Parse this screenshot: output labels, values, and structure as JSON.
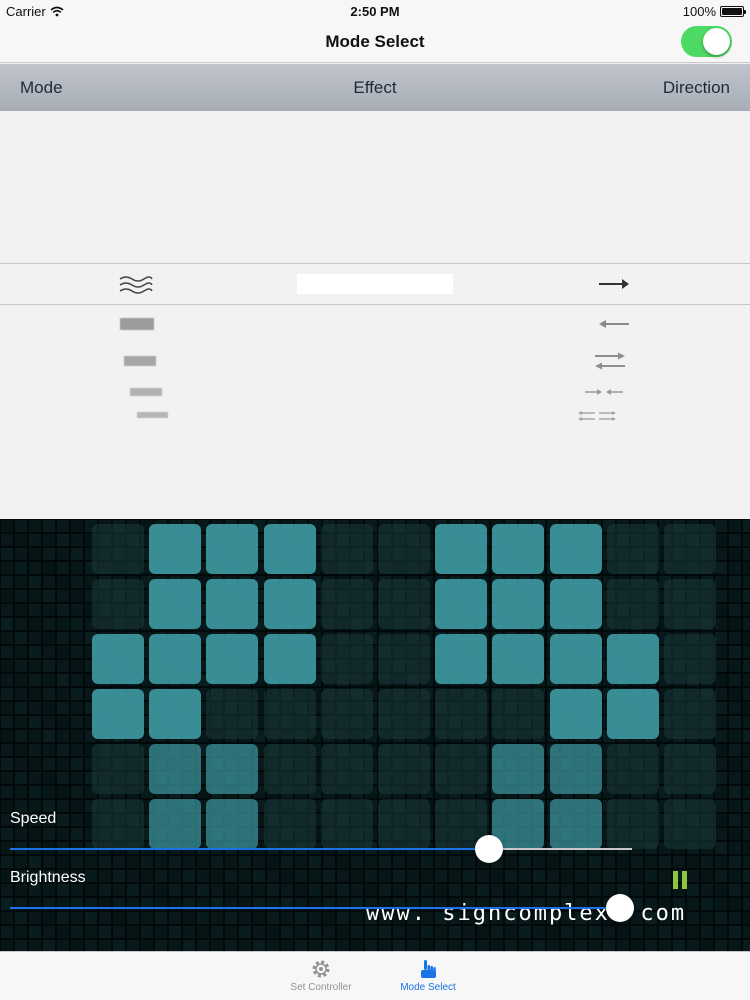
{
  "status_bar": {
    "carrier": "Carrier",
    "time": "2:50 PM",
    "battery": "100%"
  },
  "nav": {
    "title": "Mode Select",
    "toggle_on": true
  },
  "columns": {
    "mode": "Mode",
    "effect": "Effect",
    "direction": "Direction"
  },
  "picker": {
    "mode_icons": [
      "wave-icon",
      "bar-icon",
      "bar-icon",
      "bar-icon",
      "bar-icon"
    ],
    "direction_icons": [
      "arrow-right-icon",
      "arrow-left-icon",
      "arrows-bidirectional-icon",
      "arrows-converge-icon",
      "arrows-diverge-icon"
    ]
  },
  "preview": {
    "watermark": "www. signcomplex. com",
    "speed_label": "Speed",
    "speed_value": 0.77,
    "brightness_label": "Brightness",
    "brightness_value": 0.98,
    "pause_icon": "pause-icon",
    "accent": "#1a73e8",
    "tile_color": "#3f9aa3"
  },
  "tabs": [
    {
      "label": "Set Controller",
      "icon": "gear-icon",
      "active": false
    },
    {
      "label": "Mode Select",
      "icon": "hand-pointer-icon",
      "active": true
    }
  ]
}
